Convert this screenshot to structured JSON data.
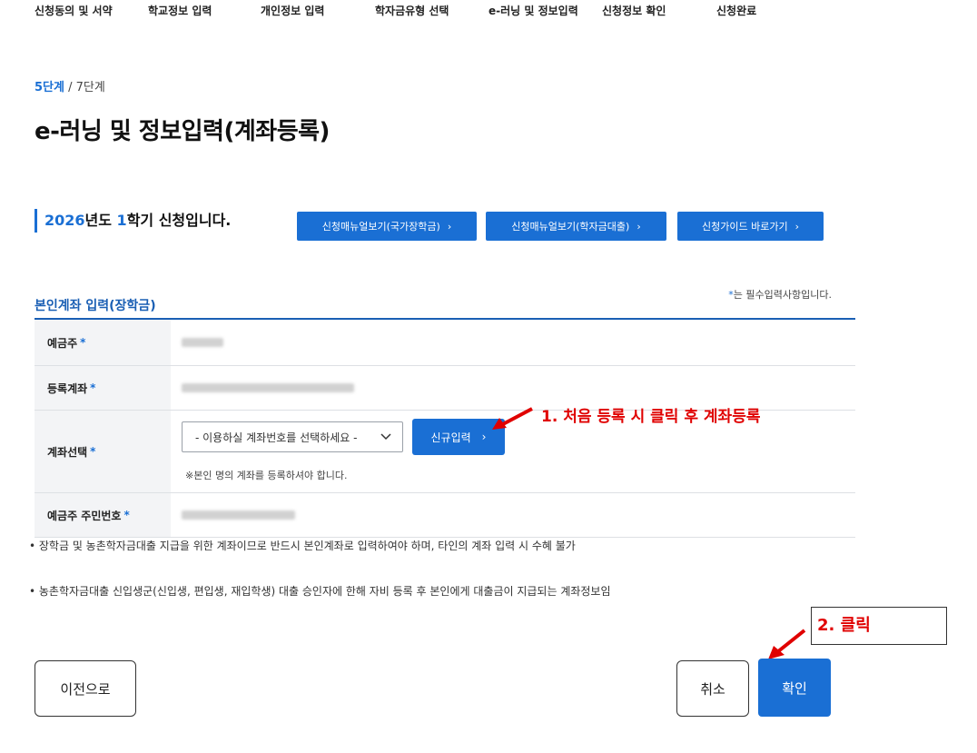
{
  "steps": [
    "신청동의 및 서약",
    "학교정보 입력",
    "개인정보 입력",
    "학자금유형 선택",
    "e-러닝 및 정보입력",
    "신청정보 확인",
    "신청완료"
  ],
  "step_counter": {
    "current": "5단계",
    "total": "/ 7단계"
  },
  "page_title": "e-러닝 및 정보입력(계좌등록)",
  "semester": {
    "year": "2026",
    "year_suffix": "년도 ",
    "term": "1",
    "term_suffix": "학기 신청입니다."
  },
  "guide_buttons": [
    {
      "label": "신청매뉴얼보기(국가장학금)"
    },
    {
      "label": "신청매뉴얼보기(학자금대출)"
    },
    {
      "label": "신청가이드 바로가기"
    }
  ],
  "required_note": {
    "star": "*",
    "text": "는 필수입력사항입니다."
  },
  "section_title": "본인계좌 입력(장학금)",
  "form": {
    "depositor_label": "예금주",
    "registered_account_label": "등록계좌",
    "account_select_label": "계좌선택",
    "account_select_value": "- 이용하실 계좌번호를 선택하세요 -",
    "new_entry_button": "신규입력",
    "account_hint": "※본인 명의 계좌를 등록하셔야 합니다.",
    "resident_number_label": "예금주 주민번호",
    "required_star": "*"
  },
  "notices": [
    "• 장학금 및 농촌학자금대출 지급을 위한 계좌이므로 반드시 본인계좌로 입력하여야 하며, 타인의 계좌 입력 시 수혜 불가",
    "• 농촌학자금대출 신입생군(신입생, 편입생, 재입학생) 대출 승인자에 한해 자비 등록 후 본인에게 대출금이 지급되는 계좌정보임"
  ],
  "annotations": {
    "first_register": "1. 처음 등록 시 클릭 후 계좌등록",
    "click": "2. 클릭",
    "color": "#e00000"
  },
  "buttons": {
    "prev": "이전으로",
    "cancel": "취소",
    "confirm": "확인"
  },
  "colors": {
    "primary": "#1a6fd4",
    "section": "#1a5fb4"
  }
}
